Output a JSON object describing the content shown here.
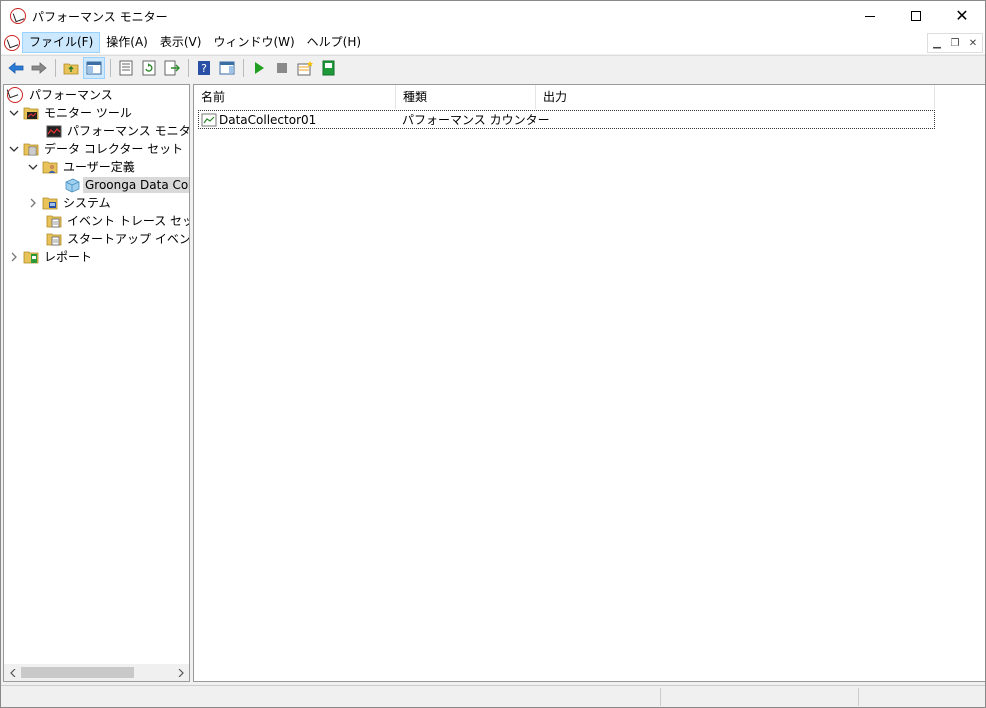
{
  "window": {
    "title": "パフォーマンス モニター"
  },
  "menu": {
    "items": [
      {
        "label": "ファイル(F)"
      },
      {
        "label": "操作(A)"
      },
      {
        "label": "表示(V)"
      },
      {
        "label": "ウィンドウ(W)"
      },
      {
        "label": "ヘルプ(H)"
      }
    ]
  },
  "tree": {
    "items": [
      {
        "label": "パフォーマンス",
        "icon": "perfmon-icon"
      },
      {
        "label": "モニター ツール",
        "icon": "folder-chart-icon",
        "expanded": true
      },
      {
        "label": "パフォーマンス モニター",
        "icon": "chart-icon"
      },
      {
        "label": "データ コレクター セット",
        "icon": "folder-clipboard-icon",
        "expanded": true
      },
      {
        "label": "ユーザー定義",
        "icon": "folder-user-icon",
        "expanded": true
      },
      {
        "label": "Groonga Data Colle",
        "icon": "data-collector-icon",
        "selected": true
      },
      {
        "label": "システム",
        "icon": "folder-system-icon",
        "expanded": false
      },
      {
        "label": "イベント トレース セッション",
        "icon": "folder-trace-icon"
      },
      {
        "label": "スタートアップ イベント トレ-",
        "icon": "folder-trace-icon"
      },
      {
        "label": "レポート",
        "icon": "folder-report-icon",
        "expanded": false
      }
    ]
  },
  "list": {
    "columns": [
      {
        "label": "名前"
      },
      {
        "label": "種類"
      },
      {
        "label": "出力"
      }
    ],
    "rows": [
      {
        "name": "DataCollector01",
        "type": "パフォーマンス カウンター",
        "output": ""
      }
    ]
  }
}
